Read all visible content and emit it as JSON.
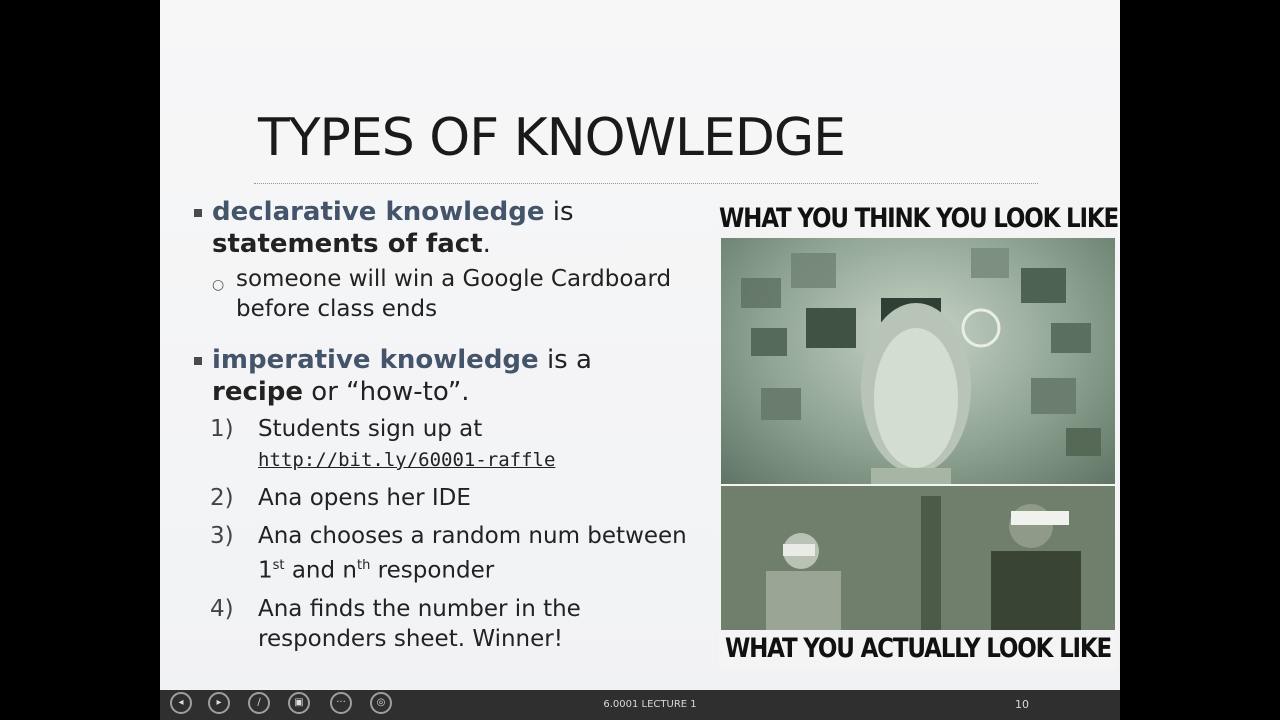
{
  "slide": {
    "title": "TYPES OF KNOWLEDGE",
    "bullet1": {
      "term": "declarative knowledge",
      "mid": " is ",
      "bold": "statements of fact",
      "end": "."
    },
    "sub1": "someone will win a Google Cardboard before class ends",
    "bullet2": {
      "term": "imperative knowledge",
      "mid": " is a ",
      "bold": "recipe",
      "end": " or “how-to”."
    },
    "steps": {
      "s1": {
        "num": "1)",
        "text": "Students sign up at",
        "link": "http://bit.ly/60001-raffle"
      },
      "s2": {
        "num": "2)",
        "text": "Ana opens her IDE"
      },
      "s3": {
        "num": "3)",
        "pre": "Ana chooses a random num between 1",
        "sup1": "st",
        "mid": " and n",
        "sup2": "th",
        "post": " responder"
      },
      "s4": {
        "num": "4)",
        "text": "Ana finds the number in the responders sheet. Winner!"
      }
    },
    "meme": {
      "top_caption": "WHAT YOU THINK YOU LOOK LIKE",
      "bottom_caption": "WHAT YOU ACTUALLY LOOK LIKE"
    }
  },
  "statusbar": {
    "lecture_label": "6.0001 LECTURE 1",
    "page_number": "10",
    "controls": {
      "prev": "◂",
      "next": "▸",
      "pen": "∕",
      "view": "▣",
      "more": "···",
      "zoom": "◎"
    }
  }
}
